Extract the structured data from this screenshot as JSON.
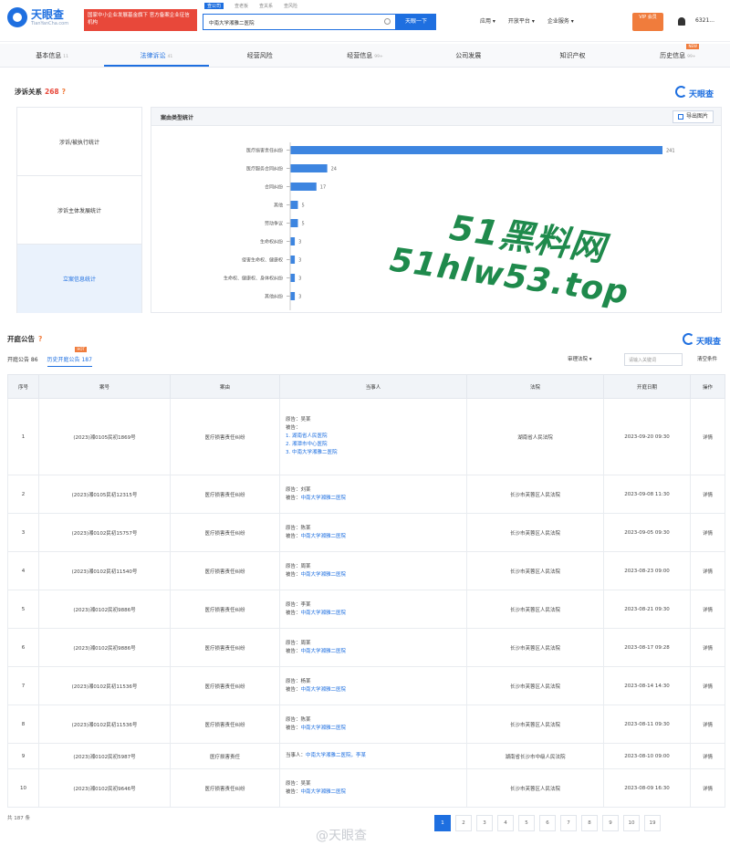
{
  "header": {
    "logo_cn": "天眼查",
    "logo_url": "TianYanCha.com",
    "notice": "国家中小企业发展基金旗下 官方备案企业征信机构",
    "search_tabs": [
      "查公司",
      "查老板",
      "查关系",
      "查风险"
    ],
    "search_value": "中南大学湘雅二医院",
    "search_button": "天眼一下",
    "nav_right": [
      "应用 ▾",
      "开放平台 ▾",
      "企业服务 ▾"
    ],
    "vip_label": "VIP 会员",
    "user": "6321..."
  },
  "section_tabs": [
    {
      "label": "基本信息",
      "sup": "11"
    },
    {
      "label": "法律诉讼",
      "sup": "41"
    },
    {
      "label": "经营风险",
      "sup": ""
    },
    {
      "label": "经营信息",
      "sup": "99+"
    },
    {
      "label": "公司发展",
      "sup": ""
    },
    {
      "label": "知识产权",
      "sup": ""
    },
    {
      "label": "历史信息",
      "sup": "99+"
    }
  ],
  "section_tabs_new_badge": "NEW",
  "litigation": {
    "title": "涉诉关系",
    "count": "268",
    "brand": "天眼查",
    "side_items": [
      "涉诉/被执行统计",
      "涉诉主体发展统计",
      "立案信息统计"
    ],
    "chart_title": "案由类型统计",
    "export_label": "导出图片"
  },
  "chart_data": {
    "type": "bar",
    "title": "案由类型统计",
    "categories": [
      "医疗损害责任纠纷",
      "医疗服务合同纠纷",
      "合同纠纷",
      "其他",
      "劳动争议",
      "生命权纠纷",
      "侵害生命权、健康权",
      "生命权、健康权、身体权纠纷",
      "其他纠纷"
    ],
    "values": [
      241,
      24,
      17,
      5,
      5,
      3,
      3,
      3,
      3
    ],
    "accent": "#3d85e0"
  },
  "watermark": {
    "line1": "51黑料网",
    "line2": "51hlw53.top"
  },
  "court": {
    "title": "开庭公告",
    "brand": "天眼查",
    "sub_tabs": [
      "开庭公告 86",
      "历史开庭公告 187"
    ],
    "hot_badge": "HOT",
    "filter_select": "审理法院 ▾",
    "filter_placeholder": "请输入关键词",
    "filter_clear": "清空条件",
    "columns": [
      "序号",
      "案号",
      "案由",
      "当事人",
      "法院",
      "开庭日期",
      "操作"
    ],
    "rows": [
      {
        "no": "1",
        "case": "(2023)湘0105民初1869号",
        "cause": "医疗损害责任纠纷",
        "p1": "原告：吴某",
        "p2": "被告：",
        "p3": "1. 湖南省人民医院",
        "p4": "2. 湘潭市中心医院",
        "p5": "3. 中南大学湘雅二医院",
        "court": "湖南省人民法院",
        "date": "2023-09-20 09:30",
        "op": "详情"
      },
      {
        "no": "2",
        "case": "(2023)湘0105民初12315号",
        "cause": "医疗损害责任纠纷",
        "p1": "原告：刘某",
        "p2": "被告：",
        "p3": "中南大学湘雅二医院",
        "p4": "",
        "p5": "",
        "court": "长沙市芙蓉区人民法院",
        "date": "2023-09-08 11:30",
        "op": "详情"
      },
      {
        "no": "3",
        "case": "(2023)湘0102民初15757号",
        "cause": "医疗损害责任纠纷",
        "p1": "原告：陈某",
        "p2": "被告：",
        "p3": "中南大学湘雅二医院",
        "p4": "",
        "p5": "",
        "court": "长沙市芙蓉区人民法院",
        "date": "2023-09-05 09:30",
        "op": "详情"
      },
      {
        "no": "4",
        "case": "(2023)湘0102民初11540号",
        "cause": "医疗损害责任纠纷",
        "p1": "原告：周某",
        "p2": "被告：",
        "p3": "中南大学湘雅二医院",
        "p4": "",
        "p5": "",
        "court": "长沙市芙蓉区人民法院",
        "date": "2023-08-23 09:00",
        "op": "详情"
      },
      {
        "no": "5",
        "case": "(2023)湘0102民初9886号",
        "cause": "医疗损害责任纠纷",
        "p1": "原告：李某",
        "p2": "被告：",
        "p3": "中南大学湘雅二医院",
        "p4": "",
        "p5": "",
        "court": "长沙市芙蓉区人民法院",
        "date": "2023-08-21 09:30",
        "op": "详情"
      },
      {
        "no": "6",
        "case": "(2023)湘0102民初9886号",
        "cause": "医疗损害责任纠纷",
        "p1": "原告：周某",
        "p2": "被告：",
        "p3": "中南大学湘雅二医院",
        "p4": "",
        "p5": "",
        "court": "长沙市芙蓉区人民法院",
        "date": "2023-08-17 09:28",
        "op": "详情"
      },
      {
        "no": "7",
        "case": "(2023)湘0102民初11536号",
        "cause": "医疗损害责任纠纷",
        "p1": "原告：杨某",
        "p2": "被告：",
        "p3": "中南大学湘雅二医院",
        "p4": "",
        "p5": "",
        "court": "长沙市芙蓉区人民法院",
        "date": "2023-08-14 14:30",
        "op": "详情"
      },
      {
        "no": "8",
        "case": "(2023)湘0102民初11536号",
        "cause": "医疗损害责任纠纷",
        "p1": "原告：陈某",
        "p2": "被告：",
        "p3": "中南大学湘雅二医院",
        "p4": "",
        "p5": "",
        "court": "长沙市芙蓉区人民法院",
        "date": "2023-08-11 09:30",
        "op": "详情"
      },
      {
        "no": "9",
        "case": "(2023)湘0102民初5987号",
        "cause": "医疗损害责任",
        "p1": "当事人：",
        "p2": "中南大学湘雅二医院，李某",
        "p3": "",
        "p4": "",
        "p5": "",
        "court": "湖南省长沙市中级人民法院",
        "date": "2023-08-10 09:00",
        "op": "详情"
      },
      {
        "no": "10",
        "case": "(2023)湘0102民初9646号",
        "cause": "医疗损害责任纠纷",
        "p1": "原告：吴某",
        "p2": "被告：",
        "p3": "中南大学湘雅二医院",
        "p4": "",
        "p5": "",
        "court": "长沙市芙蓉区人民法院",
        "date": "2023-08-09 16:30",
        "op": "详情"
      }
    ],
    "total": "共 187 条",
    "pages": [
      "1",
      "2",
      "3",
      "4",
      "5",
      "6",
      "7",
      "8",
      "9",
      "10",
      "19"
    ],
    "weibo_mark": "@天眼查"
  }
}
